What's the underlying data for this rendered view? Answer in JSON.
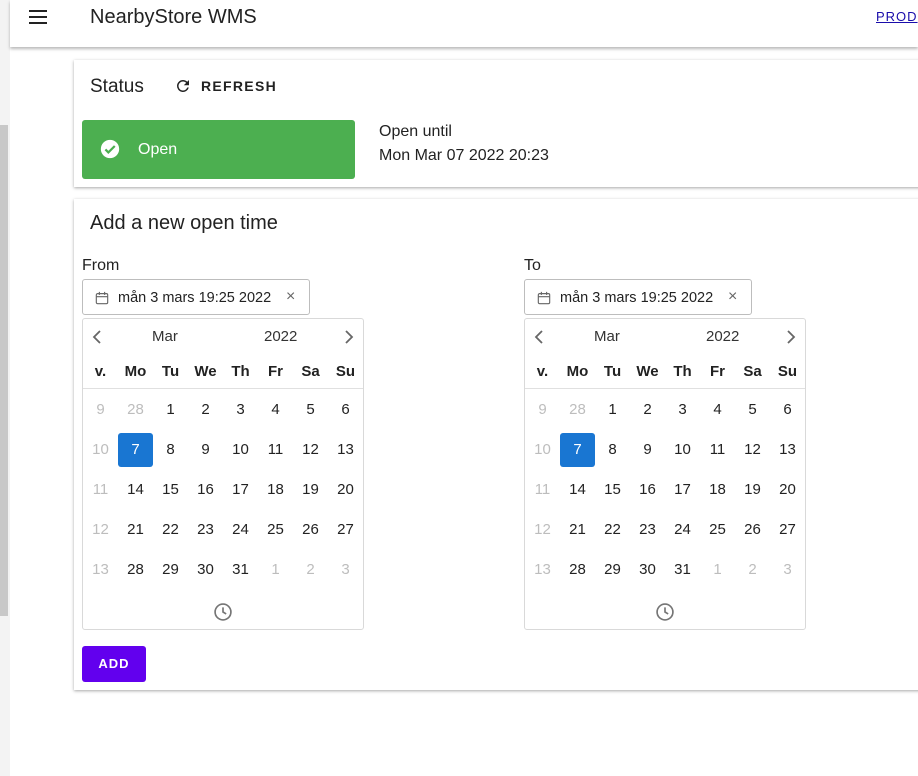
{
  "app": {
    "title": "NearbyStore WMS",
    "prod_link": "PROD"
  },
  "status": {
    "title": "Status",
    "refresh_label": "REFRESH",
    "state_label": "Open",
    "open_until_label": "Open until",
    "open_until_value": "Mon Mar 07 2022 20:23",
    "state_color": "#4caf50"
  },
  "add_open_time": {
    "title": "Add a new open time",
    "add_label": "ADD",
    "accent_color": "#6200ee",
    "selected_color": "#1976d2",
    "pickers": [
      {
        "label": "From",
        "value": "mån 3 mars 19:25 2022",
        "clear_glyph": "×",
        "month": "Mar",
        "year": "2022",
        "weekday_headers": [
          "v.",
          "Mo",
          "Tu",
          "We",
          "Th",
          "Fr",
          "Sa",
          "Su"
        ],
        "weeks": [
          {
            "week": "9",
            "days": [
              {
                "d": "28",
                "out": true
              },
              {
                "d": "1"
              },
              {
                "d": "2"
              },
              {
                "d": "3"
              },
              {
                "d": "4"
              },
              {
                "d": "5"
              },
              {
                "d": "6"
              }
            ]
          },
          {
            "week": "10",
            "days": [
              {
                "d": "7",
                "selected": true
              },
              {
                "d": "8"
              },
              {
                "d": "9"
              },
              {
                "d": "10"
              },
              {
                "d": "11"
              },
              {
                "d": "12"
              },
              {
                "d": "13"
              }
            ]
          },
          {
            "week": "11",
            "days": [
              {
                "d": "14"
              },
              {
                "d": "15"
              },
              {
                "d": "16"
              },
              {
                "d": "17"
              },
              {
                "d": "18"
              },
              {
                "d": "19"
              },
              {
                "d": "20"
              }
            ]
          },
          {
            "week": "12",
            "days": [
              {
                "d": "21"
              },
              {
                "d": "22"
              },
              {
                "d": "23"
              },
              {
                "d": "24"
              },
              {
                "d": "25"
              },
              {
                "d": "26"
              },
              {
                "d": "27"
              }
            ]
          },
          {
            "week": "13",
            "days": [
              {
                "d": "28"
              },
              {
                "d": "29"
              },
              {
                "d": "30"
              },
              {
                "d": "31"
              },
              {
                "d": "1",
                "out": true
              },
              {
                "d": "2",
                "out": true
              },
              {
                "d": "3",
                "out": true
              }
            ]
          }
        ]
      },
      {
        "label": "To",
        "value": "mån 3 mars 19:25 2022",
        "clear_glyph": "×",
        "month": "Mar",
        "year": "2022",
        "weekday_headers": [
          "v.",
          "Mo",
          "Tu",
          "We",
          "Th",
          "Fr",
          "Sa",
          "Su"
        ],
        "weeks": [
          {
            "week": "9",
            "days": [
              {
                "d": "28",
                "out": true
              },
              {
                "d": "1"
              },
              {
                "d": "2"
              },
              {
                "d": "3"
              },
              {
                "d": "4"
              },
              {
                "d": "5"
              },
              {
                "d": "6"
              }
            ]
          },
          {
            "week": "10",
            "days": [
              {
                "d": "7",
                "selected": true
              },
              {
                "d": "8"
              },
              {
                "d": "9"
              },
              {
                "d": "10"
              },
              {
                "d": "11"
              },
              {
                "d": "12"
              },
              {
                "d": "13"
              }
            ]
          },
          {
            "week": "11",
            "days": [
              {
                "d": "14"
              },
              {
                "d": "15"
              },
              {
                "d": "16"
              },
              {
                "d": "17"
              },
              {
                "d": "18"
              },
              {
                "d": "19"
              },
              {
                "d": "20"
              }
            ]
          },
          {
            "week": "12",
            "days": [
              {
                "d": "21"
              },
              {
                "d": "22"
              },
              {
                "d": "23"
              },
              {
                "d": "24"
              },
              {
                "d": "25"
              },
              {
                "d": "26"
              },
              {
                "d": "27"
              }
            ]
          },
          {
            "week": "13",
            "days": [
              {
                "d": "28"
              },
              {
                "d": "29"
              },
              {
                "d": "30"
              },
              {
                "d": "31"
              },
              {
                "d": "1",
                "out": true
              },
              {
                "d": "2",
                "out": true
              },
              {
                "d": "3",
                "out": true
              }
            ]
          }
        ]
      }
    ]
  },
  "icons": {
    "menu": "menu-icon",
    "refresh": "refresh-icon",
    "status": "check-circle-icon",
    "calendar": "calendar-icon",
    "clear": "close-icon",
    "prev": "chevron-left-icon",
    "next": "chevron-right-icon",
    "time": "clock-icon"
  }
}
